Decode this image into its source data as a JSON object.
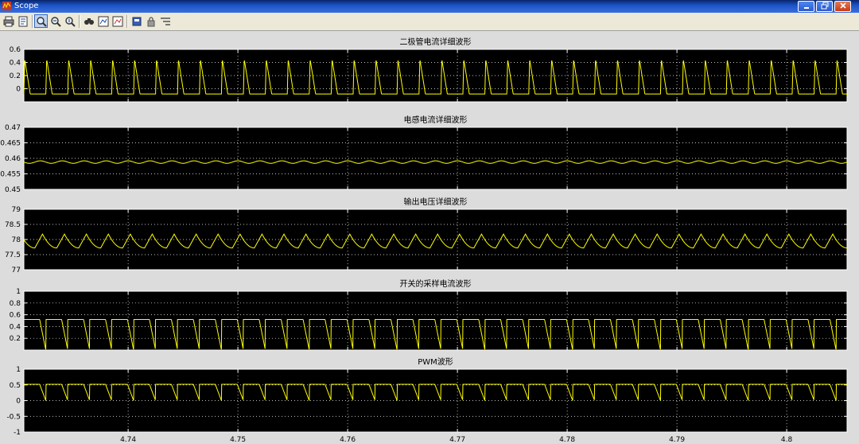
{
  "window": {
    "title": "Scope"
  },
  "toolbar": {
    "buttons": [
      {
        "name": "print-icon"
      },
      {
        "name": "parameters-icon"
      },
      {
        "name": "zoom-icon"
      },
      {
        "name": "zoom-x-icon"
      },
      {
        "name": "zoom-y-icon"
      },
      {
        "name": "autoscale-icon"
      },
      {
        "name": "save-axes-icon"
      },
      {
        "name": "restore-axes-icon"
      },
      {
        "name": "floating-scope-icon"
      },
      {
        "name": "lock-axes-icon"
      },
      {
        "name": "signal-selector-icon"
      }
    ]
  },
  "colors": {
    "plot_bg": "#000000",
    "trace": "#ffff00",
    "grid": "#ffffff",
    "figure_bg": "#dcdcdc"
  },
  "chart_data": [
    {
      "type": "line",
      "title": "二极管电流详细波形",
      "ylim": [
        -0.2,
        0.6
      ],
      "yticks": [
        {
          "v": 0.6,
          "t": "0.6"
        },
        {
          "v": 0.4,
          "t": "0.4"
        },
        {
          "v": 0.2,
          "t": "0.2"
        },
        {
          "v": 0,
          "t": "0"
        }
      ],
      "xlim": [
        4.7305,
        4.8055
      ],
      "waveform": {
        "kind": "diode",
        "period": 0.002,
        "phase": 4.7325,
        "low": -0.08,
        "high": 0.45,
        "rise_fraction": 0.04,
        "fall_fraction": 0.25
      },
      "grid": true
    },
    {
      "type": "line",
      "title": "电感电流详细波形",
      "ylim": [
        0.45,
        0.47
      ],
      "yticks": [
        {
          "v": 0.47,
          "t": "0.47"
        },
        {
          "v": 0.465,
          "t": "0.465"
        },
        {
          "v": 0.46,
          "t": "0.46"
        },
        {
          "v": 0.455,
          "t": "0.455"
        },
        {
          "v": 0.45,
          "t": "0.45"
        }
      ],
      "xlim": [
        4.7305,
        4.8055
      ],
      "waveform": {
        "kind": "sine",
        "period": 0.002,
        "phase": 4.7315,
        "center": 0.4588,
        "amplitude": 0.0004
      },
      "grid": true
    },
    {
      "type": "line",
      "title": "输出电压详细波形",
      "ylim": [
        77,
        79
      ],
      "yticks": [
        {
          "v": 79,
          "t": "79"
        },
        {
          "v": 78.5,
          "t": "78.5"
        },
        {
          "v": 78,
          "t": "78"
        },
        {
          "v": 77.5,
          "t": "77.5"
        },
        {
          "v": 77,
          "t": "77"
        }
      ],
      "xlim": [
        4.7305,
        4.8055
      ],
      "waveform": {
        "kind": "ripple",
        "period": 0.002,
        "phase": 4.7315,
        "low": 77.72,
        "high": 78.18,
        "rise_fraction": 0.35
      },
      "grid": true
    },
    {
      "type": "line",
      "title": "开关的采样电流波形",
      "ylim": [
        0,
        1
      ],
      "yticks": [
        {
          "v": 1,
          "t": "1"
        },
        {
          "v": 0.8,
          "t": "0.8"
        },
        {
          "v": 0.6,
          "t": "0.6"
        },
        {
          "v": 0.4,
          "t": "0.4"
        },
        {
          "v": 0.2,
          "t": "0.2"
        }
      ],
      "xlim": [
        4.7305,
        4.8055
      ],
      "waveform": {
        "kind": "switch",
        "period": 0.002,
        "phase": 4.7305,
        "low": 0,
        "high": 0.52,
        "on_fraction": 0.72
      },
      "grid": true
    },
    {
      "type": "line",
      "title": "PWM波形",
      "ylim": [
        -1,
        1
      ],
      "yticks": [
        {
          "v": 1,
          "t": "1"
        },
        {
          "v": 0.5,
          "t": "0.5"
        },
        {
          "v": 0,
          "t": "0"
        },
        {
          "v": -0.5,
          "t": "-0.5"
        },
        {
          "v": -1,
          "t": "-1"
        }
      ],
      "xlim": [
        4.7305,
        4.8055
      ],
      "xticks": [
        {
          "v": 4.74,
          "t": "4.74"
        },
        {
          "v": 4.75,
          "t": "4.75"
        },
        {
          "v": 4.76,
          "t": "4.76"
        },
        {
          "v": 4.77,
          "t": "4.77"
        },
        {
          "v": 4.78,
          "t": "4.78"
        },
        {
          "v": 4.79,
          "t": "4.79"
        },
        {
          "v": 4.8,
          "t": "4.8"
        }
      ],
      "waveform": {
        "kind": "switch",
        "period": 0.002,
        "phase": 4.7305,
        "low": 0,
        "high": 0.52,
        "on_fraction": 0.72
      },
      "grid": true
    }
  ]
}
